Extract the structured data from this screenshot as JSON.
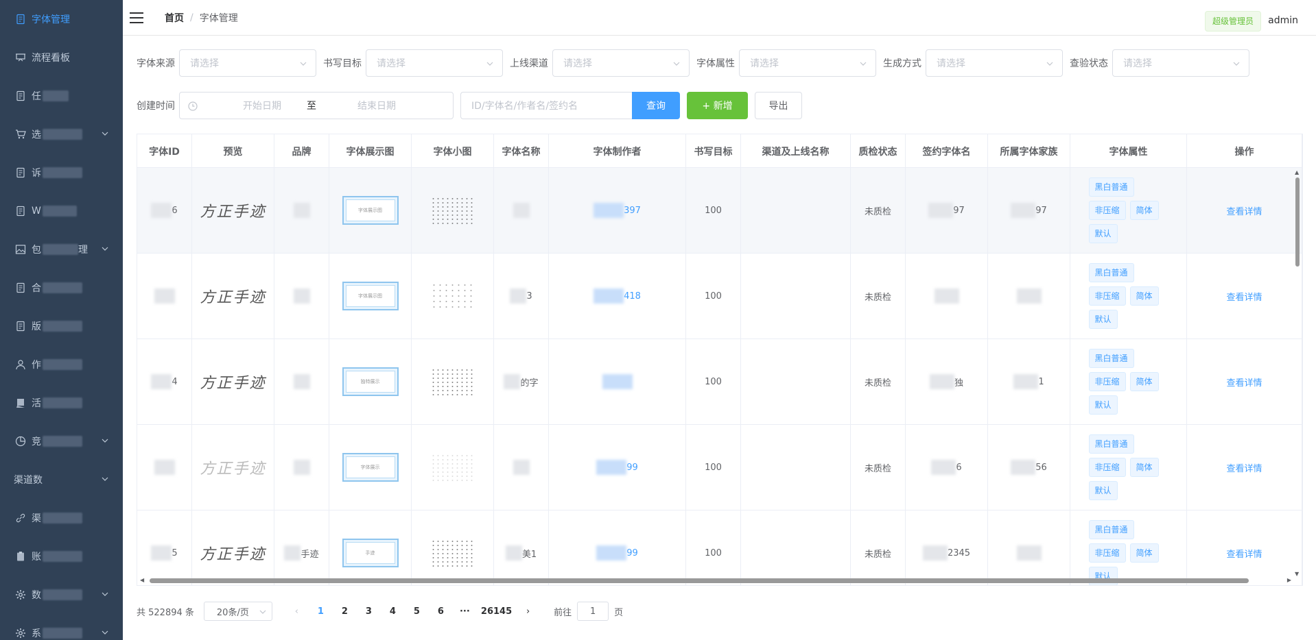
{
  "sidebar": {
    "items": [
      {
        "label": "字体管理",
        "icon": "document-icon",
        "active": true,
        "arrow": false
      },
      {
        "label": "流程看板",
        "icon": "cart-board-icon",
        "arrow": false
      },
      {
        "label": "任",
        "icon": "document-icon",
        "arrow": false
      },
      {
        "label": "选",
        "icon": "cart-icon",
        "arrow": true
      },
      {
        "label": "诉",
        "icon": "document-icon",
        "arrow": false
      },
      {
        "label": "W",
        "icon": "document-icon",
        "arrow": false
      },
      {
        "label": "包",
        "icon": "image-icon",
        "suffix": "理",
        "arrow": true
      },
      {
        "label": "合",
        "icon": "document-icon",
        "arrow": false
      },
      {
        "label": "版",
        "icon": "document-icon",
        "arrow": false
      },
      {
        "label": "作",
        "icon": "user-icon",
        "arrow": false
      },
      {
        "label": "活",
        "icon": "chat-icon",
        "arrow": false
      },
      {
        "label": "竞",
        "icon": "pie-chart-icon",
        "arrow": true
      },
      {
        "label": "渠道数",
        "icon": "",
        "arrow": true
      },
      {
        "label": "渠",
        "icon": "link-icon",
        "arrow": false
      },
      {
        "label": "账",
        "icon": "clipboard-icon",
        "arrow": false
      },
      {
        "label": "数",
        "icon": "gear-icon",
        "arrow": true
      },
      {
        "label": "系",
        "icon": "gear-icon",
        "arrow": true
      }
    ]
  },
  "header": {
    "breadcrumb_home": "首页",
    "breadcrumb_sep": "/",
    "breadcrumb_current": "字体管理",
    "role": "超级管理员",
    "username": "admin"
  },
  "filters": {
    "row1": [
      {
        "label": "字体来源",
        "placeholder": "请选择"
      },
      {
        "label": "书写目标",
        "placeholder": "请选择"
      },
      {
        "label": "上线渠道",
        "placeholder": "请选择"
      },
      {
        "label": "字体属性",
        "placeholder": "请选择"
      },
      {
        "label": "生成方式",
        "placeholder": "请选择"
      },
      {
        "label": "查验状态",
        "placeholder": "请选择"
      }
    ],
    "created_label": "创建时间",
    "start_placeholder": "开始日期",
    "range_sep": "至",
    "end_placeholder": "结束日期",
    "search_placeholder": "ID/字体名/作者名/签约名",
    "query_label": "查询",
    "add_label": "+ 新增",
    "export_label": "导出"
  },
  "table": {
    "columns": [
      "字体ID",
      "预览",
      "品牌",
      "字体展示图",
      "字体小图",
      "字体名称",
      "字体制作者",
      "书写目标",
      "渠道及上线名称",
      "质检状态",
      "签约字体名",
      "所属字体家族",
      "字体属性",
      "操作"
    ],
    "rows": [
      {
        "id": "6",
        "preview": "方正手迹",
        "brand": "",
        "name": "",
        "maker": "397",
        "target": "100",
        "qc": "未质检",
        "sign": "97",
        "family": "97",
        "showimg": "字体展示图",
        "attrs": [
          "黑白普通",
          "非压缩",
          "简体",
          "默认"
        ],
        "action": "查看详情"
      },
      {
        "id": "",
        "preview": "方正手迹",
        "brand": "",
        "name": "3",
        "maker": "418",
        "target": "100",
        "qc": "未质检",
        "sign": "",
        "family": "",
        "showimg": "字体展示图",
        "attrs": [
          "黑白普通",
          "非压缩",
          "简体",
          "默认"
        ],
        "action": "查看详情"
      },
      {
        "id": "4",
        "preview": "方正手迹",
        "brand": "",
        "name": "的字",
        "maker": "",
        "target": "100",
        "qc": "未质检",
        "sign": "独",
        "family": "1",
        "showimg": "独特展示",
        "attrs": [
          "黑白普通",
          "非压缩",
          "简体",
          "默认"
        ],
        "action": "查看详情"
      },
      {
        "id": "",
        "preview": "方正手迹",
        "brand": "",
        "name": "",
        "maker": "99",
        "target": "100",
        "qc": "未质检",
        "sign": "6",
        "family": "56",
        "showimg": "字体展示",
        "attrs": [
          "黑白普通",
          "非压缩",
          "简体",
          "默认"
        ],
        "action": "查看详情"
      },
      {
        "id": "5",
        "preview": "方正手迹",
        "brand": "手迹",
        "name": "美1",
        "maker": "99",
        "target": "100",
        "qc": "未质检",
        "sign": "2345",
        "family": "",
        "showimg": "手迹",
        "attrs": [
          "黑白普通",
          "非压缩",
          "简体",
          "默认"
        ],
        "action": "查看详情"
      }
    ]
  },
  "pagination": {
    "total": "共 522894 条",
    "page_size": "20条/页",
    "pages": [
      "1",
      "2",
      "3",
      "4",
      "5",
      "6"
    ],
    "ellipsis": "···",
    "last_page": "26145",
    "goto_label": "前往",
    "goto_value": "1",
    "page_suffix": "页"
  },
  "colors": {
    "sidebar_bg": "#304156",
    "primary": "#409eff",
    "success": "#67c23a"
  }
}
